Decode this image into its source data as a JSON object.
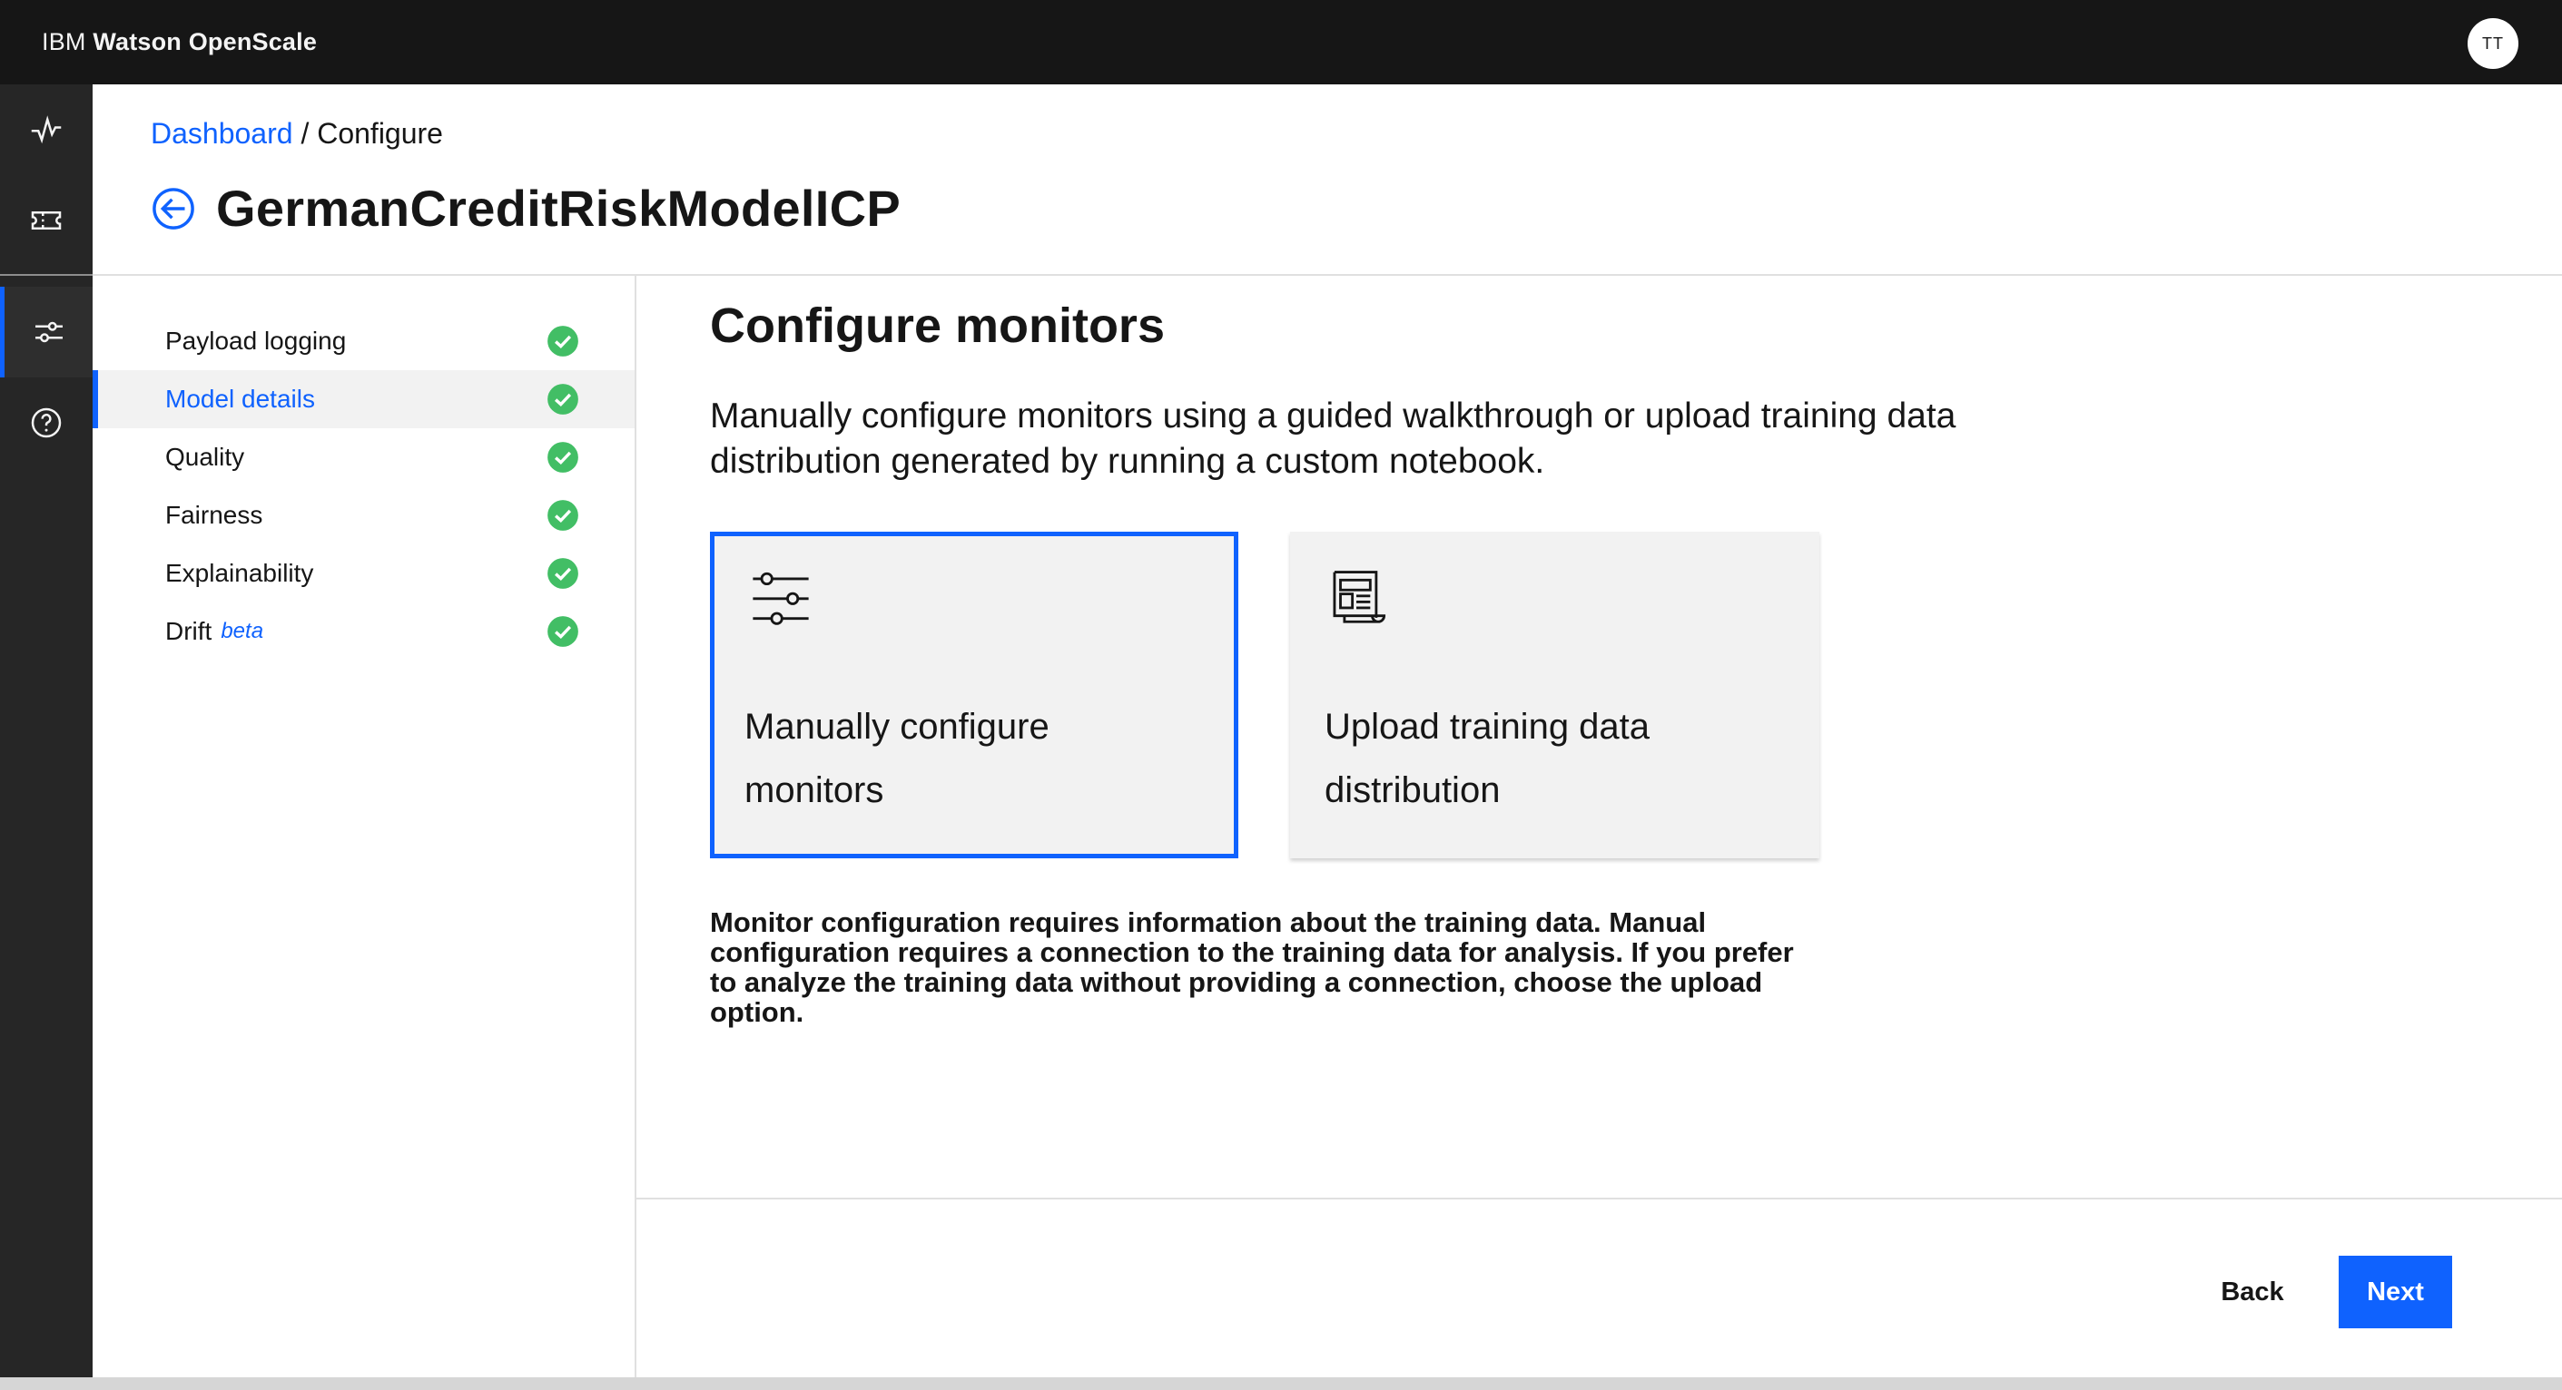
{
  "app": {
    "brand_prefix": "IBM ",
    "brand_name": "Watson OpenScale",
    "user_initials": "TT"
  },
  "rail": {
    "items": [
      {
        "icon": "activity-icon"
      },
      {
        "icon": "ticket-icon"
      },
      {
        "icon": "settings-adjust-icon",
        "active": true
      },
      {
        "icon": "help-icon"
      }
    ]
  },
  "breadcrumb": {
    "dashboard": "Dashboard",
    "separator": " / ",
    "current": "Configure"
  },
  "page": {
    "title": "GermanCreditRiskModelICP"
  },
  "steps": [
    {
      "label": "Payload logging",
      "complete": true
    },
    {
      "label": "Model details",
      "complete": true,
      "active": true
    },
    {
      "label": "Quality",
      "complete": true
    },
    {
      "label": "Fairness",
      "complete": true
    },
    {
      "label": "Explainability",
      "complete": true
    },
    {
      "label": "Drift",
      "badge": "beta",
      "complete": true
    }
  ],
  "main": {
    "section_title": "Configure monitors",
    "description": "Manually configure monitors using a guided walkthrough or upload training data distribution generated by running a custom notebook.",
    "tiles": [
      {
        "label": "Manually configure monitors",
        "icon": "sliders-icon",
        "selected": true
      },
      {
        "label": "Upload training data distribution",
        "icon": "document-icon",
        "selected": false
      }
    ],
    "note": "Monitor configuration requires information about the training data. Manual configuration requires a connection to the training data for analysis. If you prefer to analyze the training data without providing a connection, choose the upload option."
  },
  "footer": {
    "back_label": "Back",
    "next_label": "Next"
  },
  "colors": {
    "accent": "#0f62fe",
    "success": "#42be65",
    "header_bg": "#161616",
    "rail_bg": "#262626"
  }
}
